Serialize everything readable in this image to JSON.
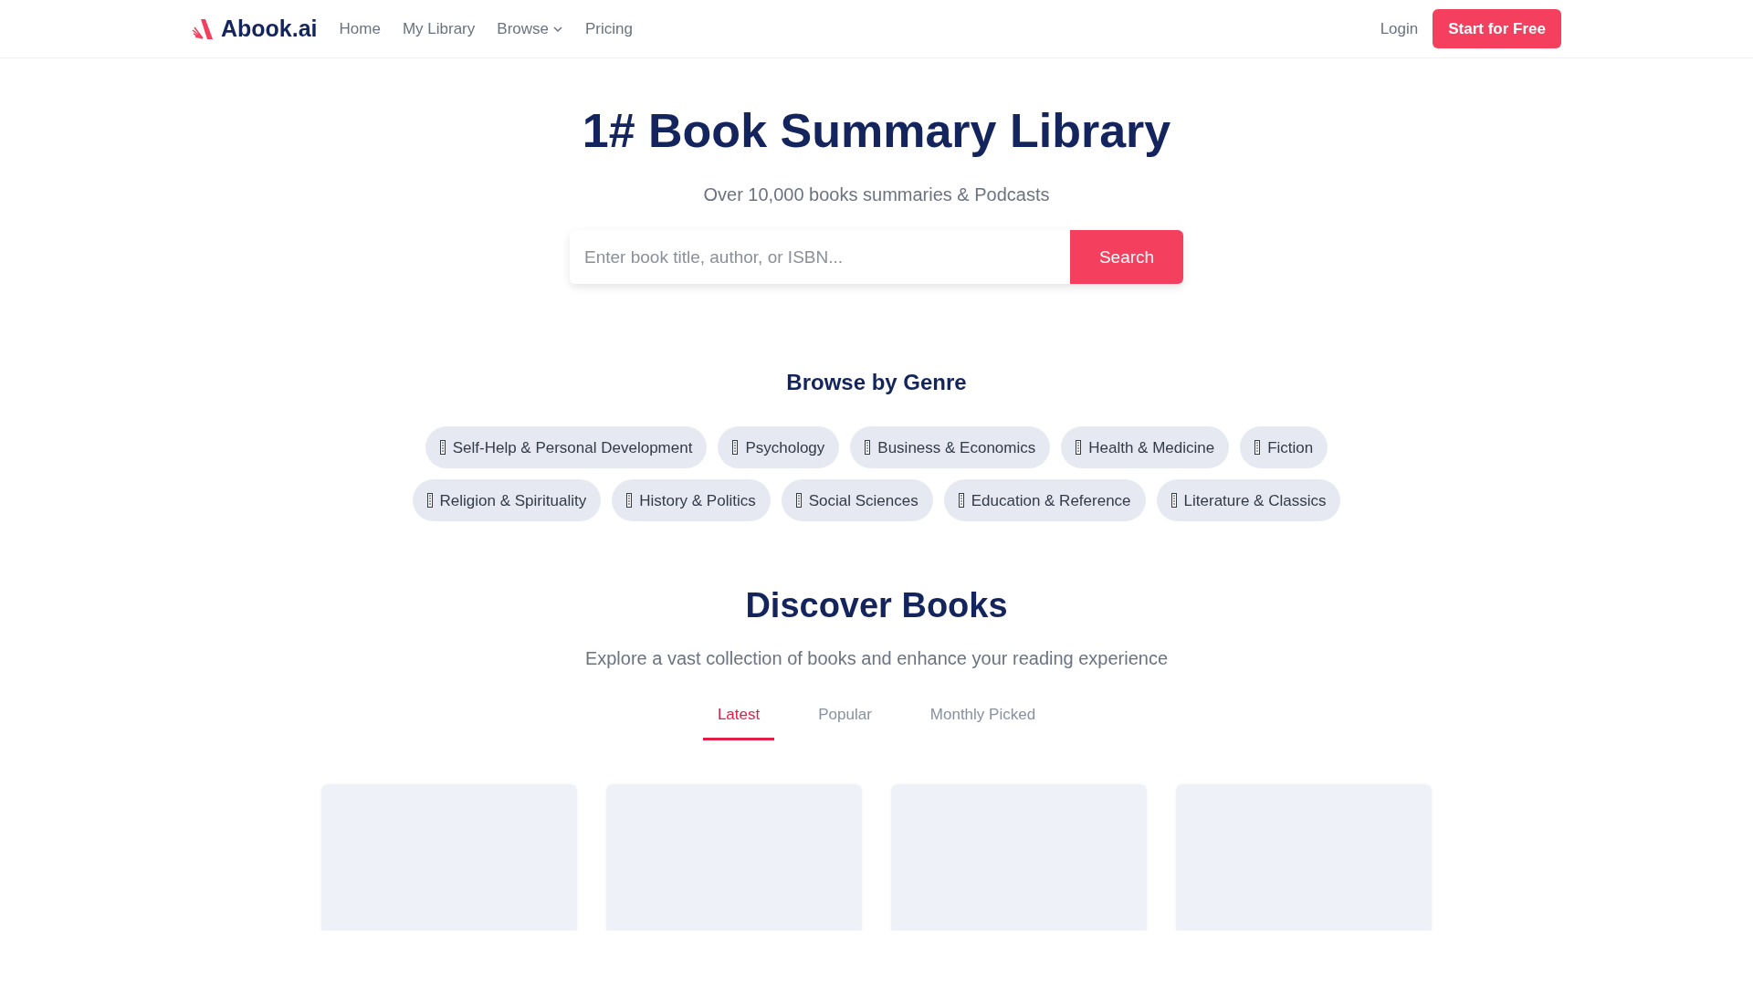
{
  "navbar": {
    "brand": "Abook.ai",
    "links": [
      {
        "label": "Home",
        "kind": "link"
      },
      {
        "label": "My Library",
        "kind": "link"
      },
      {
        "label": "Browse",
        "kind": "dropdown"
      },
      {
        "label": "Pricing",
        "kind": "link"
      }
    ],
    "login": "Login",
    "cta": "Start for Free"
  },
  "hero": {
    "title": "1# Book Summary Library",
    "subtitle": "Over 10,000 books summaries & Podcasts",
    "search": {
      "placeholder": "Enter book title, author, or ISBN...",
      "button": "Search"
    }
  },
  "genres": {
    "title": "Browse by Genre",
    "items": [
      {
        "label": "Self-Help & Personal Development"
      },
      {
        "label": "Psychology"
      },
      {
        "label": "Business & Economics"
      },
      {
        "label": "Health & Medicine"
      },
      {
        "label": "Fiction"
      },
      {
        "label": "Religion & Spirituality"
      },
      {
        "label": "History & Politics"
      },
      {
        "label": "Social Sciences"
      },
      {
        "label": "Education & Reference"
      },
      {
        "label": "Literature & Classics"
      }
    ]
  },
  "discover": {
    "title": "Discover Books",
    "subtitle": "Explore a vast collection of books and enhance your reading experience",
    "tabs": [
      {
        "label": "Latest",
        "selected": true
      },
      {
        "label": "Popular",
        "selected": false
      },
      {
        "label": "Monthly Picked",
        "selected": false
      }
    ],
    "cards": [
      {
        "kind": "placeholder"
      },
      {
        "kind": "placeholder"
      },
      {
        "kind": "placeholder"
      },
      {
        "kind": "placeholder"
      }
    ]
  }
}
